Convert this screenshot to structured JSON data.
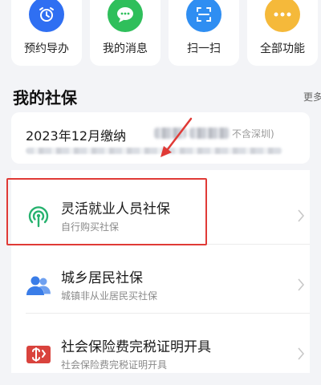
{
  "quick_actions": [
    {
      "label": "预约导办",
      "icon": "alarm-clock-icon",
      "color": "#2f6ff2"
    },
    {
      "label": "我的消息",
      "icon": "chat-bubble-icon",
      "color": "#2fbf5b"
    },
    {
      "label": "扫一扫",
      "icon": "scan-icon",
      "color": "#2f8ef2"
    },
    {
      "label": "全部功能",
      "icon": "grid-dots-icon",
      "color": "#f5b93a"
    }
  ],
  "section": {
    "title": "我的社保",
    "more": "更多"
  },
  "payment": {
    "date_text": "2023年12月缴纳",
    "note": "不含深圳)"
  },
  "items": [
    {
      "title": "灵活就业人员社保",
      "subtitle": "自行购买社保",
      "icon": "podcast-signal-icon",
      "color": "#27b26f"
    },
    {
      "title": "城乡居民社保",
      "subtitle": "城镇非从业居民买社保",
      "icon": "people-icon",
      "color": "#3a7de8"
    },
    {
      "title": "社会保险费完税证明开具",
      "subtitle": "社会保险费完税证明开具",
      "icon": "certificate-icon",
      "color": "#d9433d"
    }
  ],
  "colors": {
    "highlight": "#e03a36",
    "accent": "#2f6ff2"
  }
}
